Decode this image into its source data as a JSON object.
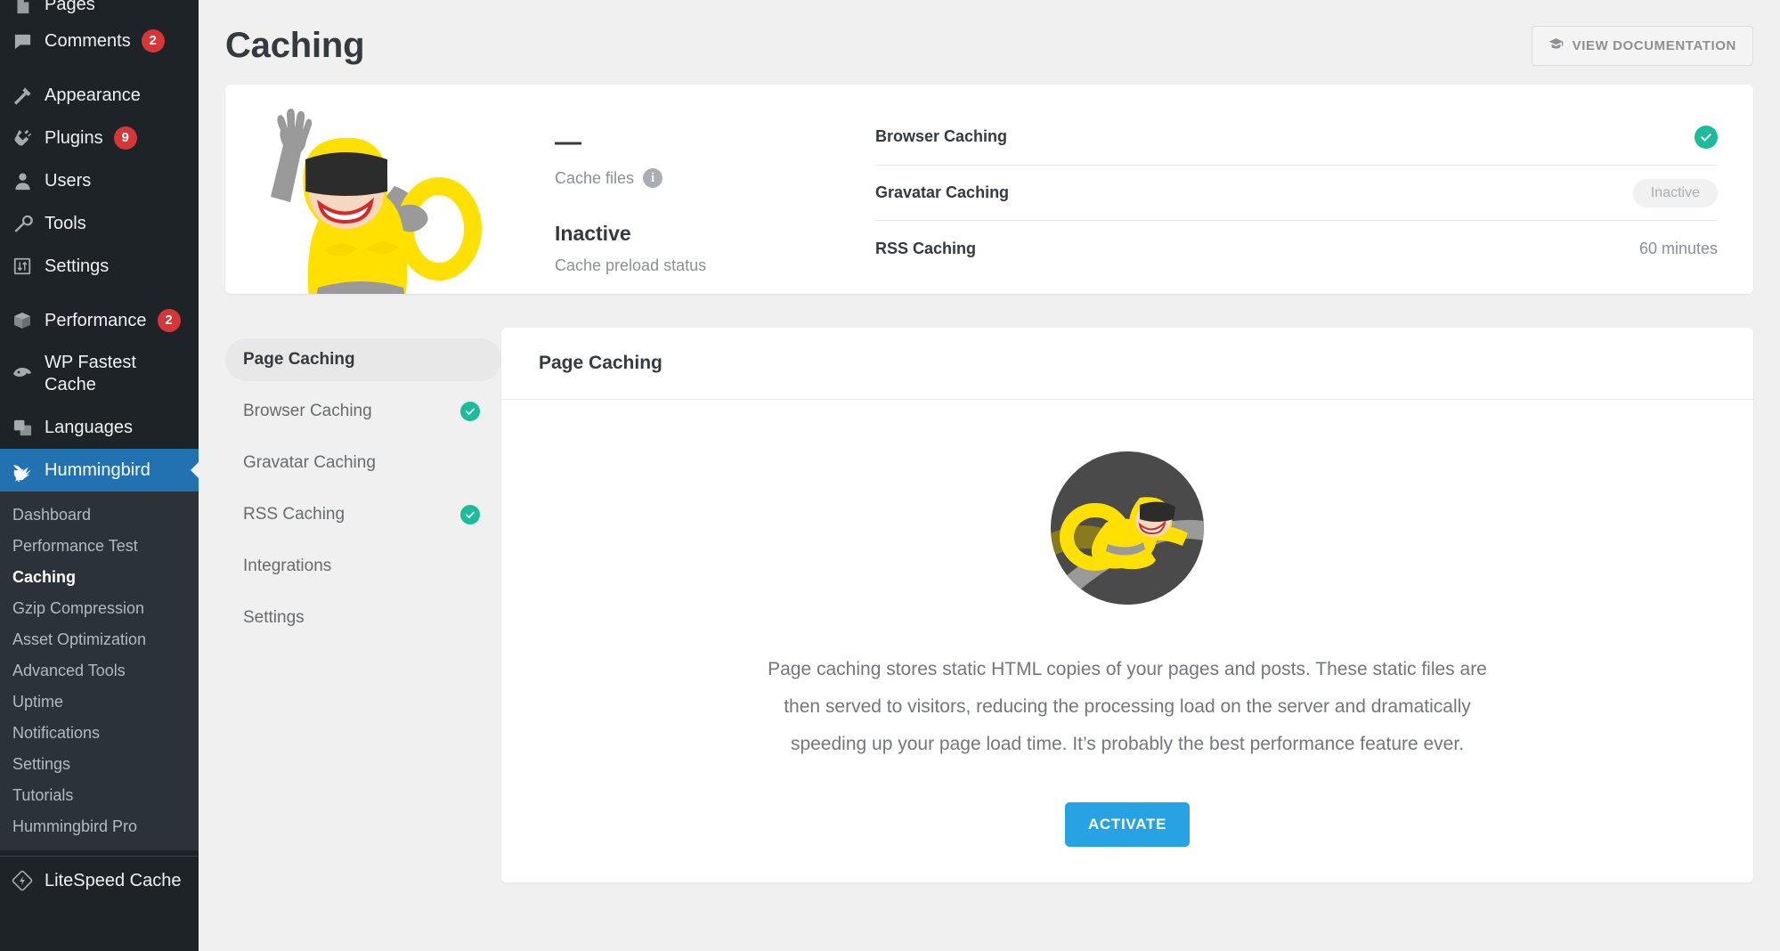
{
  "sidebar": {
    "items": [
      {
        "label": "Pages",
        "icon": "pages-icon",
        "badge": null,
        "partial": true
      },
      {
        "label": "Comments",
        "icon": "comments-icon",
        "badge": "2"
      },
      {
        "label": "Appearance",
        "icon": "appearance-icon",
        "badge": null
      },
      {
        "label": "Plugins",
        "icon": "plugins-icon",
        "badge": "9"
      },
      {
        "label": "Users",
        "icon": "users-icon",
        "badge": null
      },
      {
        "label": "Tools",
        "icon": "tools-icon",
        "badge": null
      },
      {
        "label": "Settings",
        "icon": "settings-icon",
        "badge": null
      },
      {
        "label": "Performance",
        "icon": "performance-icon",
        "badge": "2"
      },
      {
        "label": "WP Fastest\nCache",
        "icon": "wp-fastest-cache-icon",
        "badge": null
      },
      {
        "label": "Languages",
        "icon": "languages-icon",
        "badge": null
      },
      {
        "label": "Hummingbird",
        "icon": "hummingbird-icon",
        "badge": null,
        "active": true
      }
    ],
    "submenu": [
      {
        "label": "Dashboard"
      },
      {
        "label": "Performance Test"
      },
      {
        "label": "Caching",
        "current": true
      },
      {
        "label": "Gzip Compression"
      },
      {
        "label": "Asset Optimization"
      },
      {
        "label": "Advanced Tools"
      },
      {
        "label": "Uptime"
      },
      {
        "label": "Notifications"
      },
      {
        "label": "Settings"
      },
      {
        "label": "Tutorials"
      },
      {
        "label": "Hummingbird Pro"
      }
    ],
    "bottom_item": {
      "label": "LiteSpeed Cache",
      "icon": "litespeed-icon"
    },
    "active_color": "#2271b1",
    "bg_color": "#1d2327",
    "badge_color": "#d63638"
  },
  "header": {
    "title": "Caching",
    "doc_button_label": "VIEW DOCUMENTATION",
    "doc_button_icon": "graduation-cap-icon"
  },
  "summary": {
    "mascot_alt": "hummingbird-hero-illustration",
    "stats": [
      {
        "value": "—",
        "label": "Cache files",
        "has_info_icon": true,
        "info_icon": "info-icon"
      },
      {
        "value": "Inactive",
        "label": "Cache preload status",
        "has_info_icon": false
      }
    ],
    "rows": [
      {
        "label": "Browser Caching",
        "value_type": "check",
        "value": ""
      },
      {
        "label": "Gravatar Caching",
        "value_type": "pill",
        "value": "Inactive"
      },
      {
        "label": "RSS Caching",
        "value_type": "text",
        "value": "60 minutes"
      }
    ],
    "check_color": "#1abc9c"
  },
  "tabs": [
    {
      "label": "Page Caching",
      "active": true,
      "check": false
    },
    {
      "label": "Browser Caching",
      "active": false,
      "check": true
    },
    {
      "label": "Gravatar Caching",
      "active": false,
      "check": false
    },
    {
      "label": "RSS Caching",
      "active": false,
      "check": true
    },
    {
      "label": "Integrations",
      "active": false,
      "check": false
    },
    {
      "label": "Settings",
      "active": false,
      "check": false
    }
  ],
  "panel": {
    "title": "Page Caching",
    "illustration_alt": "flying-hummingbird-hero-circle",
    "description": "Page caching stores static HTML copies of your pages and posts. These static files are then served to visitors, reducing the processing load on the server and dramatically speeding up your page load time. It’s probably the best performance feature ever.",
    "activate_label": "ACTIVATE",
    "activate_color": "#27a3e4"
  }
}
